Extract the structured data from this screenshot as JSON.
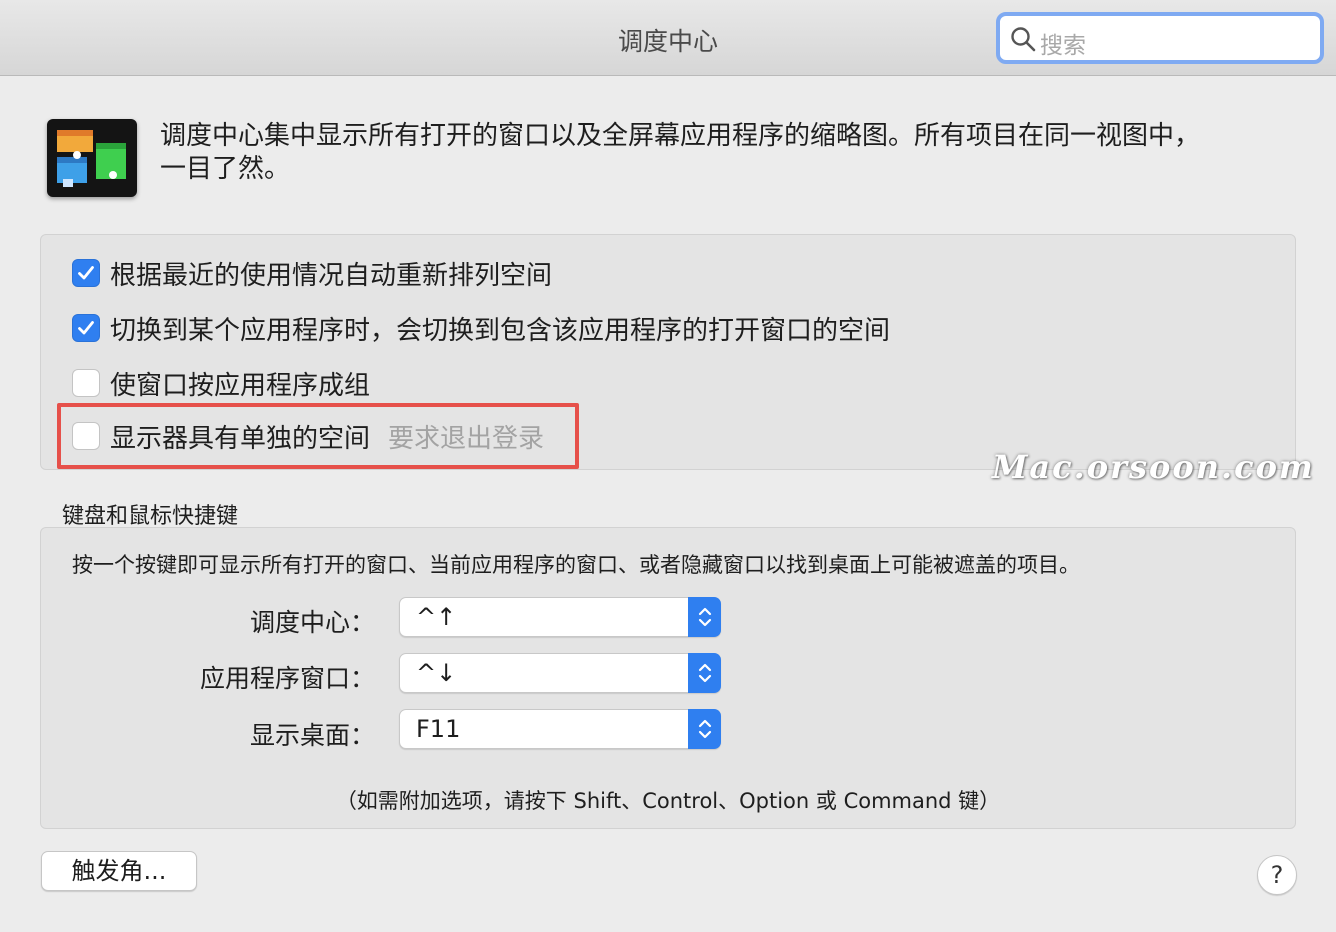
{
  "window": {
    "title": "调度中心",
    "search_placeholder": "搜索"
  },
  "header": {
    "description_line1": "调度中心集中显示所有打开的窗口以及全屏幕应用程序的缩略图。所有项目在同一视图中，",
    "description_line2": "一目了然。"
  },
  "options": [
    {
      "label": "根据最近的使用情况自动重新排列空间",
      "checked": true
    },
    {
      "label": "切换到某个应用程序时，会切换到包含该应用程序的打开窗口的空间",
      "checked": true
    },
    {
      "label": "使窗口按应用程序成组",
      "checked": false
    },
    {
      "label": "显示器具有单独的空间",
      "checked": false,
      "hint": "要求退出登录"
    }
  ],
  "watermark": "Mac.orsoon.com",
  "shortcuts": {
    "section_title": "键盘和鼠标快捷键",
    "description": "按一个按键即可显示所有打开的窗口、当前应用程序的窗口、或者隐藏窗口以找到桌面上可能被遮盖的项目。",
    "rows": [
      {
        "label": "调度中心：",
        "value": "^↑"
      },
      {
        "label": "应用程序窗口：",
        "value": "^↓"
      },
      {
        "label": "显示桌面：",
        "value": "F11"
      }
    ],
    "footnote": "（如需附加选项，请按下 Shift、Control、Option 或 Command 键）"
  },
  "buttons": {
    "hot_corners": "触发角...",
    "help": "?"
  },
  "colors": {
    "accent": "#2f7ff0",
    "highlight_box": "#e6504a"
  }
}
